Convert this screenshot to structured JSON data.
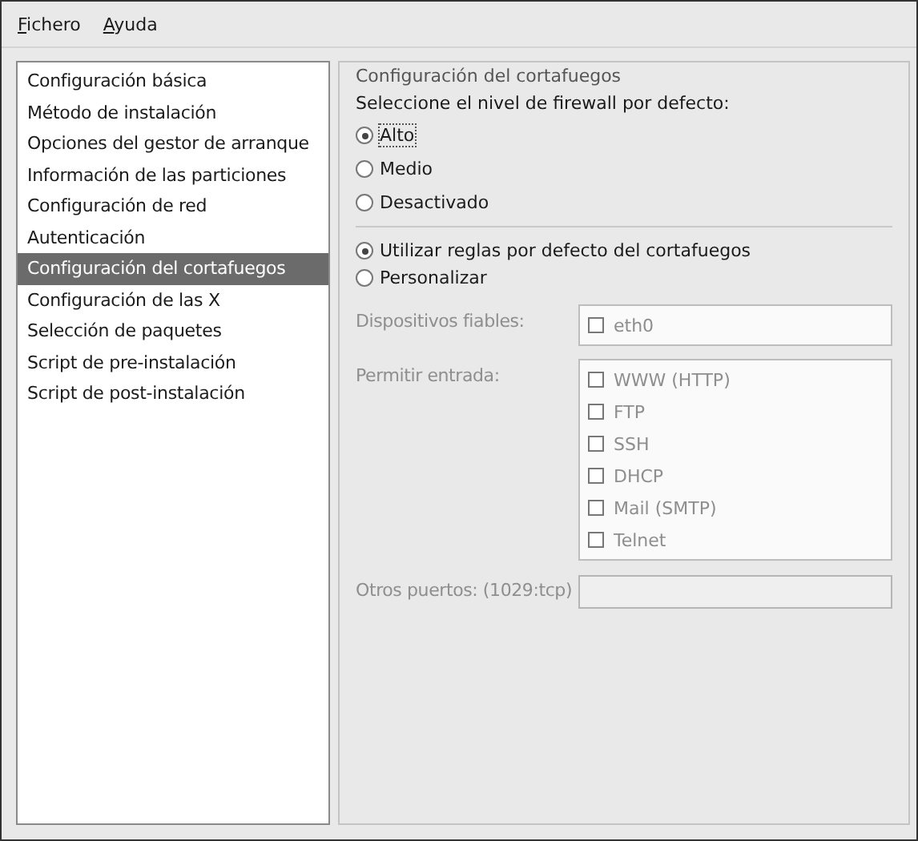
{
  "menu": [
    {
      "label": "Fichero"
    },
    {
      "label": "Ayuda"
    }
  ],
  "sidebar": {
    "items": [
      {
        "label": "Configuración básica",
        "selected": false
      },
      {
        "label": "Método de instalación",
        "selected": false
      },
      {
        "label": "Opciones del gestor de arranque",
        "selected": false
      },
      {
        "label": "Información de las particiones",
        "selected": false
      },
      {
        "label": "Configuración de red",
        "selected": false
      },
      {
        "label": "Autenticación",
        "selected": false
      },
      {
        "label": "Configuración del cortafuegos",
        "selected": true
      },
      {
        "label": "Configuración de las X",
        "selected": false
      },
      {
        "label": "Selección de paquetes",
        "selected": false
      },
      {
        "label": "Script de pre-instalación",
        "selected": false
      },
      {
        "label": "Script de post-instalación",
        "selected": false
      }
    ]
  },
  "firewall": {
    "title": "Configuración del cortafuegos",
    "prompt": "Seleccione el nivel de firewall por defecto:",
    "levels": [
      {
        "label": "Alto",
        "selected": true,
        "focused": true
      },
      {
        "label": "Medio",
        "selected": false,
        "focused": false
      },
      {
        "label": "Desactivado",
        "selected": false,
        "focused": false
      }
    ],
    "rule_modes": [
      {
        "label": "Utilizar reglas por defecto del cortafuegos",
        "selected": true
      },
      {
        "label": "Personalizar",
        "selected": false
      }
    ],
    "custom": {
      "disabled": true,
      "trusted_devices": {
        "label": "Dispositivos fiables:",
        "items": [
          {
            "label": "eth0",
            "checked": false
          }
        ]
      },
      "allow_incoming": {
        "label": "Permitir entrada:",
        "items": [
          {
            "label": "WWW (HTTP)",
            "checked": false
          },
          {
            "label": "FTP",
            "checked": false
          },
          {
            "label": "SSH",
            "checked": false
          },
          {
            "label": "DHCP",
            "checked": false
          },
          {
            "label": "Mail (SMTP)",
            "checked": false
          },
          {
            "label": "Telnet",
            "checked": false
          }
        ]
      },
      "other_ports": {
        "label": "Otros puertos: (1029:tcp)"
      }
    }
  }
}
